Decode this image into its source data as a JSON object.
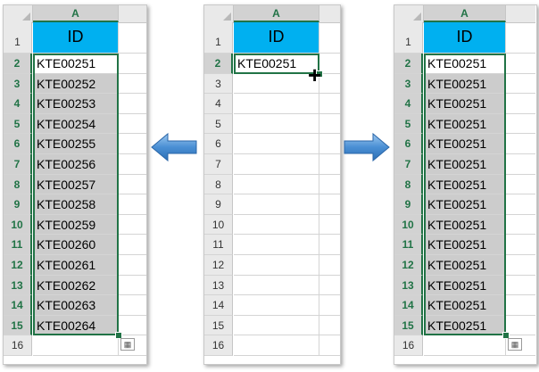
{
  "column_label": "A",
  "header_value": "ID",
  "row_numbers": [
    "1",
    "2",
    "3",
    "4",
    "5",
    "6",
    "7",
    "8",
    "9",
    "10",
    "11",
    "12",
    "13",
    "14",
    "15",
    "16"
  ],
  "left_panel": {
    "values": [
      "KTE00251",
      "KTE00252",
      "KTE00253",
      "KTE00254",
      "KTE00255",
      "KTE00256",
      "KTE00257",
      "KTE00258",
      "KTE00259",
      "KTE00260",
      "KTE00261",
      "KTE00262",
      "KTE00263",
      "KTE00264"
    ]
  },
  "middle_panel": {
    "values": [
      "KTE00251"
    ]
  },
  "right_panel": {
    "values": [
      "KTE00251",
      "KTE00251",
      "KTE00251",
      "KTE00251",
      "KTE00251",
      "KTE00251",
      "KTE00251",
      "KTE00251",
      "KTE00251",
      "KTE00251",
      "KTE00251",
      "KTE00251",
      "KTE00251",
      "KTE00251"
    ]
  },
  "colors": {
    "header_fill": "#00b0f0",
    "selection_green": "#217346",
    "fill_gray": "#cccccc",
    "arrow_blue": "#4a8fd4"
  },
  "icons": [
    "autofill-options-icon",
    "fill-handle-cursor-icon",
    "arrow-left-icon",
    "arrow-right-icon"
  ]
}
